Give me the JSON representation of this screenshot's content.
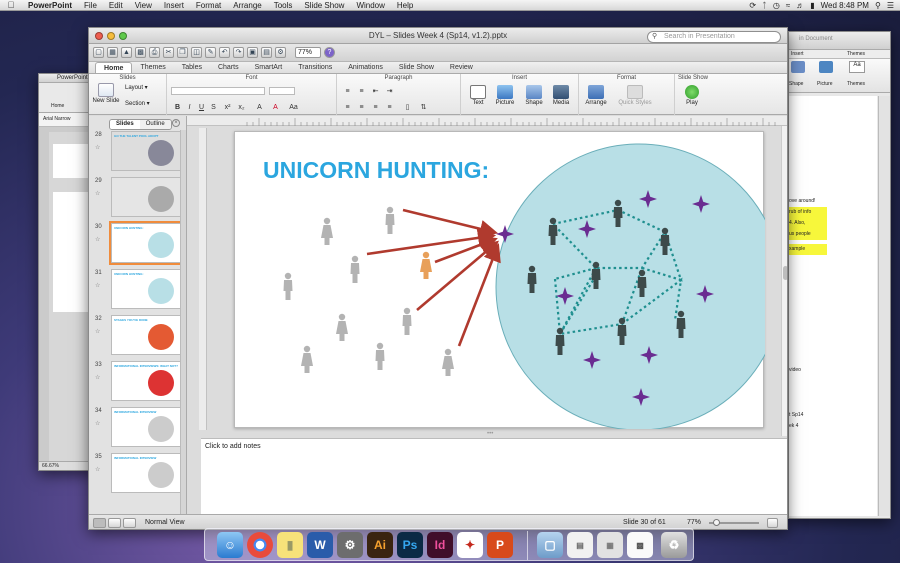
{
  "menubar": {
    "app": "PowerPoint",
    "items": [
      "File",
      "Edit",
      "View",
      "Insert",
      "Format",
      "Arrange",
      "Tools",
      "Slide Show",
      "Window",
      "Help"
    ],
    "clock": "Wed 8:48 PM"
  },
  "main_window": {
    "title": "DYL – Slides Week 4 (Sp14, v1.2).pptx",
    "zoom": "77%",
    "search_placeholder": "Search in Presentation"
  },
  "ribbon_tabs": [
    "Home",
    "Themes",
    "Tables",
    "Charts",
    "SmartArt",
    "Transitions",
    "Animations",
    "Slide Show",
    "Review"
  ],
  "ribbon": {
    "groups": {
      "slides": "Slides",
      "font": "Font",
      "paragraph": "Paragraph",
      "insert": "Insert",
      "format": "Format",
      "slideshow": "Slide Show"
    },
    "new_slide": "New Slide",
    "layout": "Layout",
    "section": "Section",
    "text": "Text",
    "picture": "Picture",
    "shape": "Shape",
    "media": "Media",
    "arrange": "Arrange",
    "quick_styles": "Quick Styles",
    "play": "Play"
  },
  "sidebar": {
    "tabs": [
      "Slides",
      "Outline"
    ],
    "thumbs": [
      {
        "num": "28",
        "title": "GO THE TALENT POOL ADOPT"
      },
      {
        "num": "29",
        "title": ""
      },
      {
        "num": "30",
        "title": "UNICORN HUNTING:"
      },
      {
        "num": "31",
        "title": "UNICORN HUNTING:"
      },
      {
        "num": "32",
        "title": "STAGES YOU'VE DONE"
      },
      {
        "num": "33",
        "title": "INFORMATIONAL INTERVIEWS: WHAT NOT?"
      },
      {
        "num": "34",
        "title": "INFORMATIONAL INTERVIEW"
      },
      {
        "num": "35",
        "title": "INFORMATIONAL INTERVIEW"
      }
    ]
  },
  "slide": {
    "title": "UNICORN HUNTING:"
  },
  "notes_placeholder": "Click to add notes",
  "status": {
    "view": "Normal View",
    "slide_count": "Slide 30 of 61",
    "zoom": "77%"
  },
  "left_window": {
    "app": "PowerPoint",
    "font": "Arial Narrow",
    "tab": "Home",
    "zoom": "66.67%"
  },
  "right_window": {
    "search": "in Document",
    "tabs": [
      "Insert",
      "Themes"
    ],
    "buttons": [
      "Shape",
      "Picture",
      "Themes"
    ],
    "text_lines": [
      "ove around!",
      "rub of info",
      "4. Also,",
      "us people",
      "xample",
      "video",
      "t Sp14",
      "ek 4"
    ]
  },
  "colors": {
    "accent": "#2ba6df",
    "circle": "#b8dfe6",
    "star": "#6a2c91",
    "arrow": "#b03a2e",
    "people_gray": "#b3b3b3",
    "people_dark": "#3d4a4a",
    "orange": "#e8a05a"
  }
}
